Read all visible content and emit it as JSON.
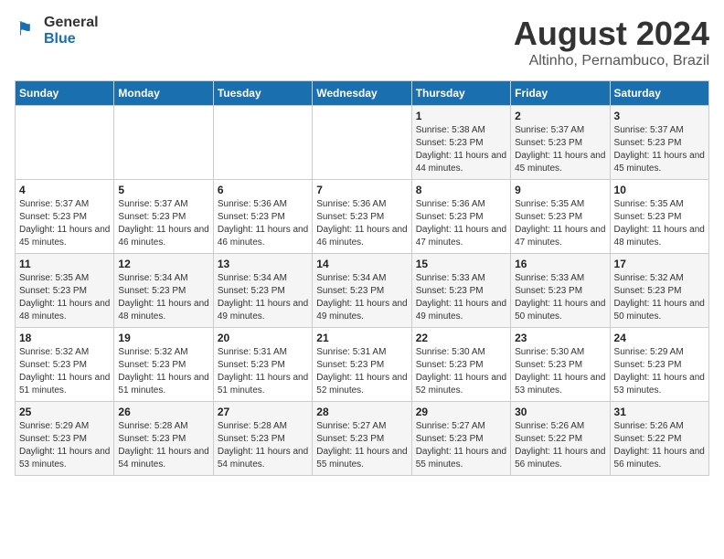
{
  "header": {
    "logo_general": "General",
    "logo_blue": "Blue",
    "title": "August 2024",
    "subtitle": "Altinho, Pernambuco, Brazil"
  },
  "calendar": {
    "days_of_week": [
      "Sunday",
      "Monday",
      "Tuesday",
      "Wednesday",
      "Thursday",
      "Friday",
      "Saturday"
    ],
    "weeks": [
      [
        {
          "day": "",
          "text": ""
        },
        {
          "day": "",
          "text": ""
        },
        {
          "day": "",
          "text": ""
        },
        {
          "day": "",
          "text": ""
        },
        {
          "day": "1",
          "text": "Sunrise: 5:38 AM\nSunset: 5:23 PM\nDaylight: 11 hours and 44 minutes."
        },
        {
          "day": "2",
          "text": "Sunrise: 5:37 AM\nSunset: 5:23 PM\nDaylight: 11 hours and 45 minutes."
        },
        {
          "day": "3",
          "text": "Sunrise: 5:37 AM\nSunset: 5:23 PM\nDaylight: 11 hours and 45 minutes."
        }
      ],
      [
        {
          "day": "4",
          "text": "Sunrise: 5:37 AM\nSunset: 5:23 PM\nDaylight: 11 hours and 45 minutes."
        },
        {
          "day": "5",
          "text": "Sunrise: 5:37 AM\nSunset: 5:23 PM\nDaylight: 11 hours and 46 minutes."
        },
        {
          "day": "6",
          "text": "Sunrise: 5:36 AM\nSunset: 5:23 PM\nDaylight: 11 hours and 46 minutes."
        },
        {
          "day": "7",
          "text": "Sunrise: 5:36 AM\nSunset: 5:23 PM\nDaylight: 11 hours and 46 minutes."
        },
        {
          "day": "8",
          "text": "Sunrise: 5:36 AM\nSunset: 5:23 PM\nDaylight: 11 hours and 47 minutes."
        },
        {
          "day": "9",
          "text": "Sunrise: 5:35 AM\nSunset: 5:23 PM\nDaylight: 11 hours and 47 minutes."
        },
        {
          "day": "10",
          "text": "Sunrise: 5:35 AM\nSunset: 5:23 PM\nDaylight: 11 hours and 48 minutes."
        }
      ],
      [
        {
          "day": "11",
          "text": "Sunrise: 5:35 AM\nSunset: 5:23 PM\nDaylight: 11 hours and 48 minutes."
        },
        {
          "day": "12",
          "text": "Sunrise: 5:34 AM\nSunset: 5:23 PM\nDaylight: 11 hours and 48 minutes."
        },
        {
          "day": "13",
          "text": "Sunrise: 5:34 AM\nSunset: 5:23 PM\nDaylight: 11 hours and 49 minutes."
        },
        {
          "day": "14",
          "text": "Sunrise: 5:34 AM\nSunset: 5:23 PM\nDaylight: 11 hours and 49 minutes."
        },
        {
          "day": "15",
          "text": "Sunrise: 5:33 AM\nSunset: 5:23 PM\nDaylight: 11 hours and 49 minutes."
        },
        {
          "day": "16",
          "text": "Sunrise: 5:33 AM\nSunset: 5:23 PM\nDaylight: 11 hours and 50 minutes."
        },
        {
          "day": "17",
          "text": "Sunrise: 5:32 AM\nSunset: 5:23 PM\nDaylight: 11 hours and 50 minutes."
        }
      ],
      [
        {
          "day": "18",
          "text": "Sunrise: 5:32 AM\nSunset: 5:23 PM\nDaylight: 11 hours and 51 minutes."
        },
        {
          "day": "19",
          "text": "Sunrise: 5:32 AM\nSunset: 5:23 PM\nDaylight: 11 hours and 51 minutes."
        },
        {
          "day": "20",
          "text": "Sunrise: 5:31 AM\nSunset: 5:23 PM\nDaylight: 11 hours and 51 minutes."
        },
        {
          "day": "21",
          "text": "Sunrise: 5:31 AM\nSunset: 5:23 PM\nDaylight: 11 hours and 52 minutes."
        },
        {
          "day": "22",
          "text": "Sunrise: 5:30 AM\nSunset: 5:23 PM\nDaylight: 11 hours and 52 minutes."
        },
        {
          "day": "23",
          "text": "Sunrise: 5:30 AM\nSunset: 5:23 PM\nDaylight: 11 hours and 53 minutes."
        },
        {
          "day": "24",
          "text": "Sunrise: 5:29 AM\nSunset: 5:23 PM\nDaylight: 11 hours and 53 minutes."
        }
      ],
      [
        {
          "day": "25",
          "text": "Sunrise: 5:29 AM\nSunset: 5:23 PM\nDaylight: 11 hours and 53 minutes."
        },
        {
          "day": "26",
          "text": "Sunrise: 5:28 AM\nSunset: 5:23 PM\nDaylight: 11 hours and 54 minutes."
        },
        {
          "day": "27",
          "text": "Sunrise: 5:28 AM\nSunset: 5:23 PM\nDaylight: 11 hours and 54 minutes."
        },
        {
          "day": "28",
          "text": "Sunrise: 5:27 AM\nSunset: 5:23 PM\nDaylight: 11 hours and 55 minutes."
        },
        {
          "day": "29",
          "text": "Sunrise: 5:27 AM\nSunset: 5:23 PM\nDaylight: 11 hours and 55 minutes."
        },
        {
          "day": "30",
          "text": "Sunrise: 5:26 AM\nSunset: 5:22 PM\nDaylight: 11 hours and 56 minutes."
        },
        {
          "day": "31",
          "text": "Sunrise: 5:26 AM\nSunset: 5:22 PM\nDaylight: 11 hours and 56 minutes."
        }
      ]
    ]
  }
}
